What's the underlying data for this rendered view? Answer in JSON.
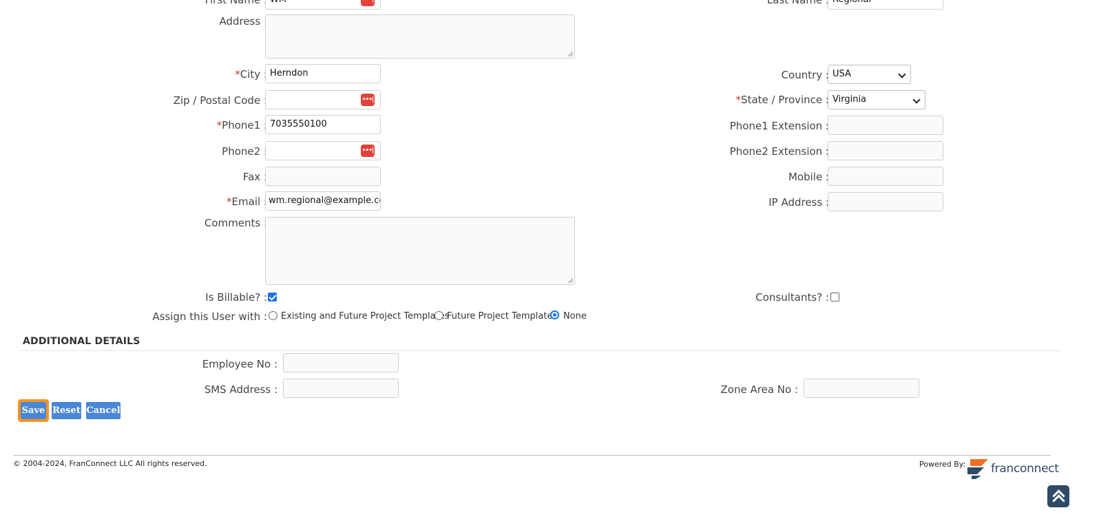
{
  "form": {
    "first_name_label": "First Name :",
    "first_name_value": "WM",
    "last_name_label": "Last Name :",
    "last_name_value": "Regional",
    "address_label": "Address :",
    "city_label": "City :",
    "city_value": "Herndon",
    "country_label": "Country :",
    "country_value": "USA",
    "zip_label": "Zip / Postal Code :",
    "state_label": "State / Province :",
    "state_value": "Virginia",
    "phone1_label": "Phone1 :",
    "phone1_value": "7035550100",
    "phone1_ext_label": "Phone1 Extension :",
    "phone2_label": "Phone2 :",
    "phone2_ext_label": "Phone2 Extension :",
    "fax_label": "Fax :",
    "mobile_label": "Mobile :",
    "email_label": "Email :",
    "email_value": "wm.regional@example.com",
    "ip_label": "IP Address :",
    "comments_label": "Comments :",
    "billable_label": "Is Billable? :",
    "billable_checked": true,
    "consultants_label": "Consultants? :",
    "consultants_checked": false,
    "assign_label": "Assign this User with :",
    "assign_options": [
      "Existing and Future Project Templates",
      "Future Project Templates",
      "None"
    ],
    "assign_selected": "None",
    "required_mark": "*",
    "password_manager_icon_text": "•••|"
  },
  "additional": {
    "title": "ADDITIONAL DETAILS",
    "employee_no_label": "Employee No :",
    "sms_label": "SMS Address :",
    "zone_label": "Zone Area No :"
  },
  "buttons": {
    "save": "Save",
    "reset": "Reset",
    "cancel": "Cancel"
  },
  "footer": {
    "copyright": "© 2004-2024, FranConnect LLC All rights reserved.",
    "powered_by": "Powered By:",
    "brand": "franconnect"
  },
  "colors": {
    "accent": "#4a86d6",
    "focus": "#f7941d",
    "required": "#c0392b",
    "brand_orange": "#f36f21",
    "brand_navy": "#2f4a66"
  }
}
